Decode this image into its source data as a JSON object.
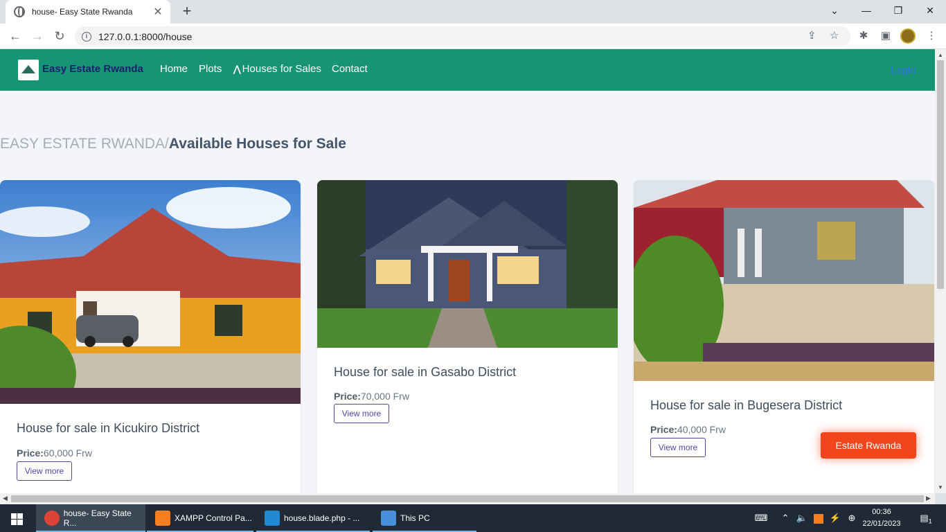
{
  "browser": {
    "tab_title": "house- Easy State Rwanda",
    "url": "127.0.0.1:8000/house",
    "new_tab": "+",
    "close_tab": "✕"
  },
  "site": {
    "brand": "Easy Estate Rwanda",
    "nav": [
      "Home",
      "Plots",
      "Houses for Sales",
      "Contact"
    ],
    "login": "Login",
    "crumb_prefix": "EASY ESTATE RWANDA/",
    "crumb_current": "Available Houses for Sale",
    "floating_label": "Estate Rwanda"
  },
  "cards": [
    {
      "title": "House for sale in Kicukiro District",
      "price_label": "Price:",
      "price": "60,000 Frw",
      "button": "View more"
    },
    {
      "title": "House for sale in Gasabo District",
      "price_label": "Price:",
      "price": "70,000 Frw",
      "button": "View more"
    },
    {
      "title": "House for sale in Bugesera District",
      "price_label": "Price:",
      "price": "40,000 Frw",
      "button": "View more"
    }
  ],
  "taskbar": {
    "items": [
      "house- Easy State R...",
      "XAMPP Control Pa...",
      "house.blade.php - ...",
      "This PC"
    ],
    "time": "00:36",
    "date": "22/01/2023",
    "notification_count": "1"
  },
  "colors": {
    "navbar": "#179473",
    "brand_text": "#1c1f6e",
    "login": "#2f6fdc",
    "badge": "#f2451c",
    "button_border": "#4f46a5"
  }
}
